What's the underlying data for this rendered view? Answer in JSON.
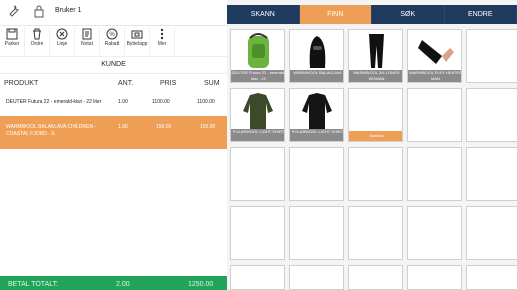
{
  "user": {
    "name": "Bruker 1"
  },
  "toolbar": [
    {
      "label": "Parker",
      "icon": "save-icon"
    },
    {
      "label": "Ordre",
      "icon": "trash-icon"
    },
    {
      "label": "Linje",
      "icon": "x-circle-icon"
    },
    {
      "label": "Notat",
      "icon": "note-icon"
    },
    {
      "label": "Rabatt",
      "icon": "percent-icon"
    },
    {
      "label": "Byttelapp",
      "icon": "tag-icon"
    },
    {
      "label": "Mer",
      "icon": "more-vertical-icon"
    }
  ],
  "customer_label": "KUNDE",
  "table": {
    "headers": {
      "product": "PRODUKT",
      "qty": "ANT.",
      "price": "PRIS",
      "sum": "SUM"
    },
    "rows": [
      {
        "product": "DEUTER Futura 22 - emerald-kiwi - 22 liter",
        "qty": "1.00",
        "price": "1100.00",
        "sum": "1100.00",
        "selected": false
      },
      {
        "product": "WARMWOOL BALAKLAVA CHILDREN - COASTAL FJORD - S",
        "qty": "1.00",
        "price": "150.00",
        "sum": "150.00",
        "selected": true
      }
    ]
  },
  "totals": {
    "label": "BETAL TOTALT:",
    "qty": "2.00",
    "sum": "1250.00"
  },
  "tabs": [
    {
      "label": "SKANN",
      "active": false
    },
    {
      "label": "FINN",
      "active": true
    },
    {
      "label": "SØK",
      "active": false
    },
    {
      "label": "ENDRE",
      "active": false
    }
  ],
  "products": [
    {
      "caption": "DEUTER Futura 22 - emerald-kiwi - 22",
      "image": "backpack"
    },
    {
      "caption": "WARMWOOL BALAKLAVA",
      "image": "balaclava"
    },
    {
      "caption": "WARMWOOL 3/4 LONGS WOMAN",
      "image": "leggings"
    },
    {
      "caption": "WARMWOOL FLEX HEATER MAN",
      "image": "wrist"
    },
    {
      "caption": "",
      "image": "empty"
    },
    {
      "caption": "POLARWOOL LIGHT SHIRT",
      "image": "shirt-green"
    },
    {
      "caption": "POLARWOOL LIGHT SHIRT",
      "image": "shirt-black"
    },
    {
      "caption": "Solution",
      "image": "orange"
    }
  ],
  "colors": {
    "navy": "#1f3a5f",
    "accent": "#ef9f55",
    "total": "#22a35a"
  }
}
